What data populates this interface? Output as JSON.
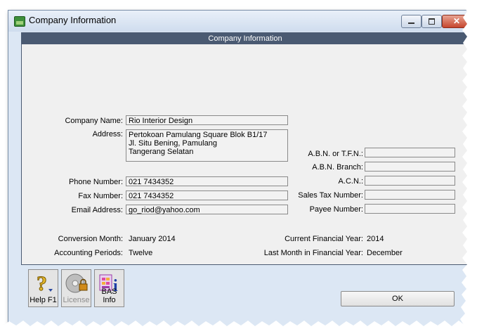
{
  "window": {
    "title": "Company Information"
  },
  "panel": {
    "header": "Company Information",
    "company_name_label": "Company Name:",
    "company_name": "Rio Interior Design",
    "address_label": "Address:",
    "address_lines": [
      "Pertokoan Pamulang Square Blok B1/17",
      "Jl. Situ Bening, Pamulang",
      "Tangerang Selatan"
    ],
    "phone_label": "Phone Number:",
    "phone": "021 7434352",
    "fax_label": "Fax Number:",
    "fax": "021 7434352",
    "email_label": "Email Address:",
    "email": "go_riod@yahoo.com",
    "abn_label": "A.B.N. or T.F.N.:",
    "abn_branch_label": "A.B.N. Branch:",
    "acn_label": "A.C.N.:",
    "sales_tax_label": "Sales Tax Number:",
    "payee_label": "Payee Number:",
    "abn": "",
    "abn_branch": "",
    "acn": "",
    "sales_tax": "",
    "payee": "",
    "conversion_month_label": "Conversion Month:",
    "conversion_month": "January 2014",
    "accounting_periods_label": "Accounting Periods:",
    "accounting_periods": "Twelve",
    "current_fy_label": "Current Financial Year:",
    "current_fy": "2014",
    "last_month_fy_label": "Last Month in Financial Year:",
    "last_month_fy": "December"
  },
  "toolbar": {
    "help_label": "Help F1",
    "license_label": "License",
    "bas_label": "BAS Info",
    "ok_label": "OK"
  },
  "colors": {
    "panel_header": "#4a5a72",
    "window_frame": "#dce7f4"
  }
}
